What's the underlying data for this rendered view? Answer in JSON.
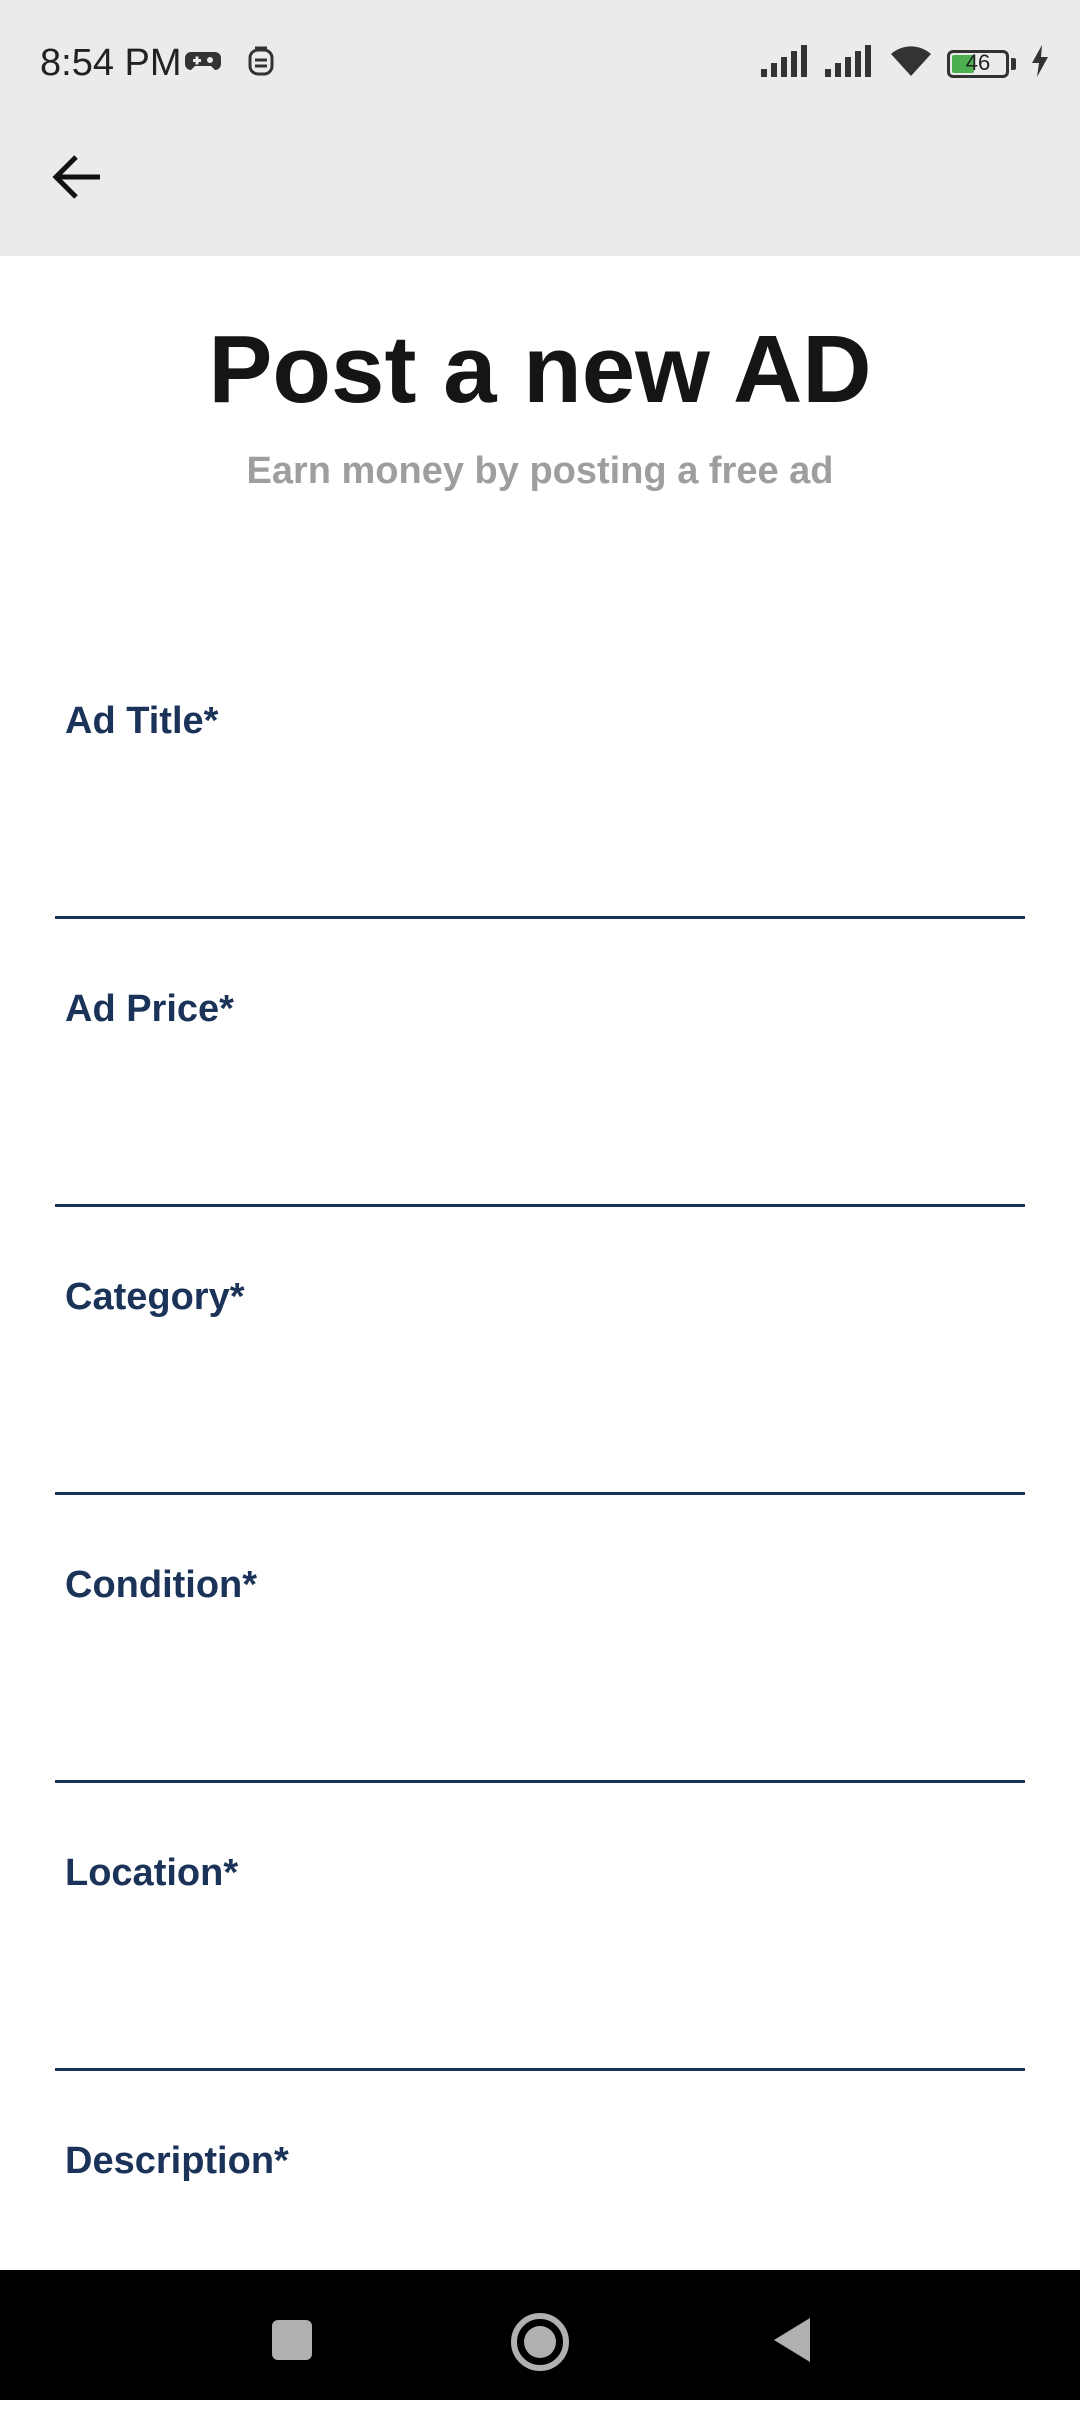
{
  "status_bar": {
    "time": "8:54 PM",
    "battery_level": "46",
    "icons": [
      "game-controller-icon",
      "notification-face-icon",
      "signal-icon",
      "signal-icon-2",
      "wifi-icon",
      "battery-icon",
      "charging-icon"
    ]
  },
  "toolbar": {
    "back_icon": "arrow-back-icon"
  },
  "header": {
    "title": "Post a new AD",
    "subtitle": "Earn money by posting a free ad"
  },
  "form": {
    "fields": [
      {
        "label": "Ad Title*",
        "value": ""
      },
      {
        "label": "Ad Price*",
        "value": ""
      },
      {
        "label": "Category*",
        "value": ""
      },
      {
        "label": "Condition*",
        "value": ""
      },
      {
        "label": "Location*",
        "value": ""
      },
      {
        "label": "Description*",
        "value": ""
      }
    ]
  },
  "colors": {
    "label": "#1b3358",
    "title": "#151515",
    "subtitle": "#9e9e9e",
    "appbar": "#ebebeb",
    "navbar": "#000000"
  },
  "navigation_bar": {
    "buttons": [
      "recents-square-icon",
      "home-circle-icon",
      "back-triangle-icon"
    ]
  }
}
